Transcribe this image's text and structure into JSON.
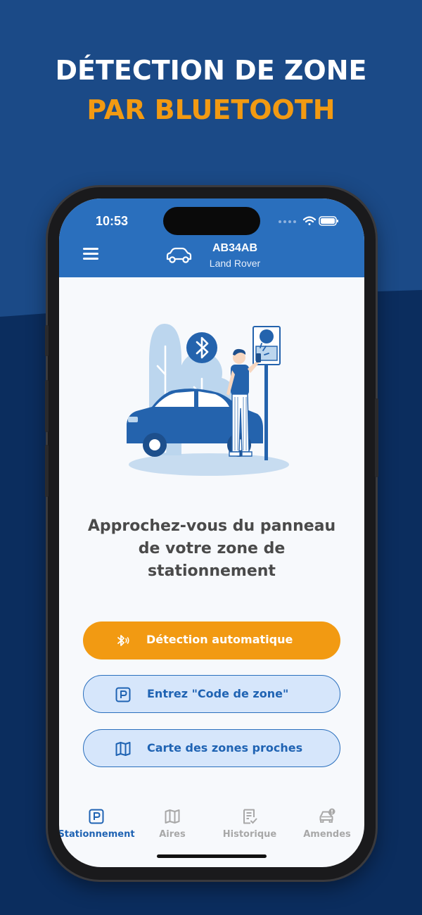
{
  "headline": {
    "line1": "DÉTECTION DE ZONE",
    "line2": "PAR BLUETOOTH"
  },
  "status_bar": {
    "time": "10:53"
  },
  "header": {
    "plate": "AB34AB",
    "model": "Land Rover",
    "menu_icon": "hamburger-icon",
    "car_icon": "car-icon"
  },
  "main": {
    "message": "Approchez-vous du panneau de votre zone de stationnement"
  },
  "actions": {
    "auto_detect": {
      "label": "Détection automatique",
      "icon": "bluetooth-icon"
    },
    "zone_code": {
      "label": "Entrez \"Code de zone\"",
      "icon": "parking-icon"
    },
    "nearby_map": {
      "label": "Carte des zones proches",
      "icon": "map-icon"
    }
  },
  "tabs": [
    {
      "label": "Stationnement",
      "icon": "parking-icon",
      "active": true
    },
    {
      "label": "Aires",
      "icon": "map-icon",
      "active": false
    },
    {
      "label": "Historique",
      "icon": "history-icon",
      "active": false
    },
    {
      "label": "Amendes",
      "icon": "car-alert-icon",
      "active": false
    }
  ],
  "colors": {
    "background": "#1b4a87",
    "primary": "#2a6fbd",
    "accent": "#f29a12",
    "secondary_fill": "#d6e6fb",
    "inactive_tab": "#a8a8a8"
  }
}
